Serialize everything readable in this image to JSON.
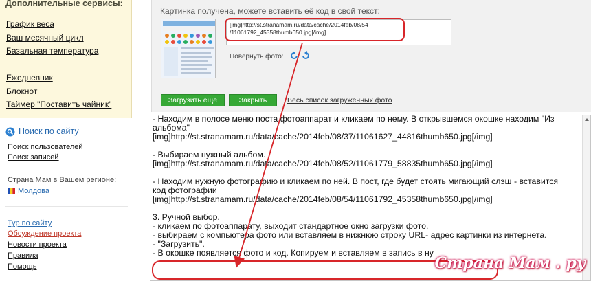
{
  "sidebar": {
    "heading": "Дополнительные сервисы:",
    "services_group1": [
      "График веса",
      "Ваш месячный цикл",
      "Базальная температура"
    ],
    "services_group2": [
      "Ежедневник",
      "Блокнот",
      "Таймер \"Поставить чайник\""
    ],
    "search_link": "Поиск по сайту",
    "search_links": [
      "Поиск пользователей",
      "Поиск записей"
    ],
    "region_label": "Страна Мам в Вашем регионе:",
    "region_link": "Молдова",
    "bottom_links": [
      "Тур по сайту",
      "Обсуждение проекта",
      "Новости проекта",
      "Правила",
      "Помощь"
    ]
  },
  "upload_panel": {
    "caption": "Картинка получена, можете вставить её код в свой текст:",
    "code_lines": [
      "[img]http://st.stranamam.ru/data/cache/2014feb/08/54",
      "/11061792_45358thumb650.jpg[/img]"
    ],
    "rotate_label": "Повернуть фото:",
    "upload_more_button": "Загрузить ещё",
    "close_button": "Закрыть",
    "all_photos_link": "Весь список загруженных фото"
  },
  "editor": {
    "lines": [
      "- Находим в полосе меню поста фотоаппарат и кликаем по нему. В открывшемся окошке находим \"Из",
      "альбома\"",
      "[img]http://st.stranamam.ru/data/cache/2014feb/08/37/11061627_44816thumb650.jpg[/img]",
      "",
      "- Выбираем нужный альбом.",
      "[img]http://st.stranamam.ru/data/cache/2014feb/08/52/11061779_58835thumb650.jpg[/img]",
      "",
      "- Находим нужную фотографию и кликаем по ней. В пост, где будет стоять мигающий слэш - вставится",
      "код фотографии",
      "[img]http://st.stranamam.ru/data/cache/2014feb/08/54/11061792_45358thumb650.jpg[/img]",
      "",
      "3. Ручной выбор.",
      "- кликаем по фотоаппарату, выходит стандартное окно загрузки фото.",
      "- выбираем с компьютера фото или вставляем в нижнюю строку URL- адрес картинки из интернета.",
      "- \"Загрузить\".",
      "- В окошке появляется фото и код. Копируем и вставляем в запись в ну"
    ]
  },
  "watermark": "Страна Мам . ру",
  "colors": {
    "link_blue": "#2a6bb0",
    "button_green": "#36a836",
    "highlight_red": "#d8262a",
    "sidebar_bg": "#fdf8dd",
    "panel_bg": "#f1f1f1"
  }
}
